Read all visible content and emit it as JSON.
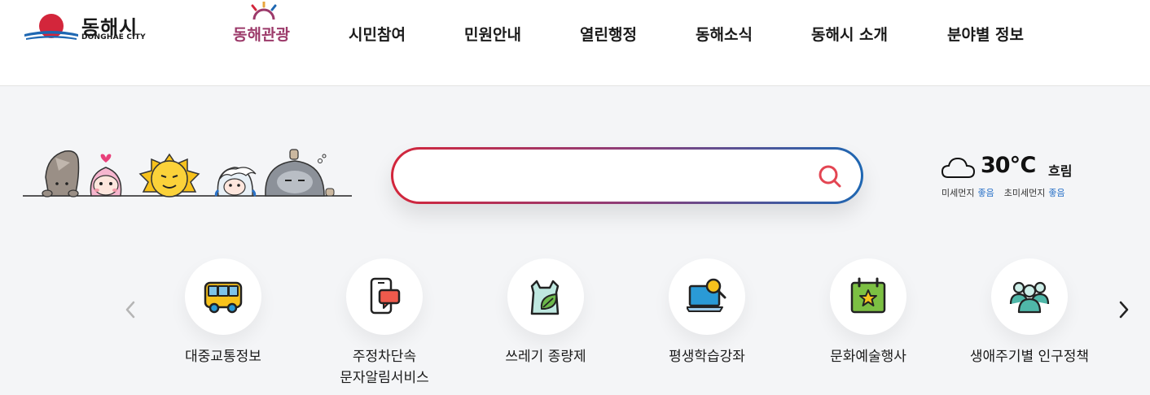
{
  "logo": {
    "ko": "동해시",
    "en": "DONGHAE CITY"
  },
  "gnb": [
    {
      "label": "동해관광"
    },
    {
      "label": "시민참여"
    },
    {
      "label": "민원안내"
    },
    {
      "label": "열린행정"
    },
    {
      "label": "동해소식"
    },
    {
      "label": "동해시 소개"
    },
    {
      "label": "분야별 정보"
    }
  ],
  "search": {
    "value": "",
    "placeholder": ""
  },
  "weather": {
    "icon": "cloud-icon",
    "temp": "30℃",
    "condition": "흐림",
    "fine_dust_label": "미세먼지",
    "fine_dust_value": "좋음",
    "ultra_dust_label": "초미세먼지",
    "ultra_dust_value": "좋음"
  },
  "quick_menu": [
    {
      "label": "대중교통정보",
      "icon": "bus-icon"
    },
    {
      "label": "주정차단속\n문자알림서비스",
      "icon": "phone-message-icon"
    },
    {
      "label": "쓰레기 종량제",
      "icon": "trash-bag-icon"
    },
    {
      "label": "평생학습강좌",
      "icon": "laptop-search-icon"
    },
    {
      "label": "문화예술행사",
      "icon": "calendar-star-icon"
    },
    {
      "label": "생애주기별 인구정책",
      "icon": "people-icon"
    }
  ],
  "colors": {
    "brand_red": "#d3263b",
    "brand_blue": "#1e67b2",
    "tour_accent": "#9c3a6a",
    "good_status": "#2a72c8"
  }
}
